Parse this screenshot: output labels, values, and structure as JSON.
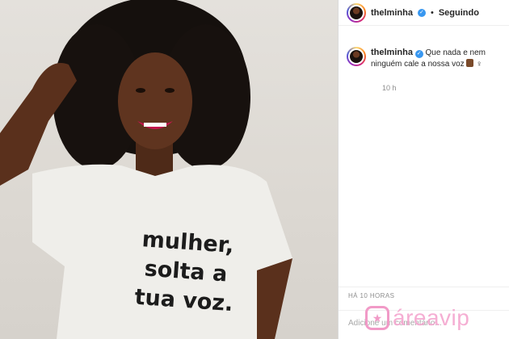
{
  "post": {
    "username": "thelminha",
    "follow_status": "Seguindo",
    "caption_text": "Que nada e nem ninguém cale a nossa voz",
    "caption_time": "10 h",
    "posted_ago": "HÁ 10 HORAS",
    "add_comment_placeholder": "Adicione um comentário..."
  },
  "photo": {
    "shirt_text_line1": "mulher,",
    "shirt_text_line2": "solta a",
    "shirt_text_line3": "tua voz."
  },
  "watermark": {
    "text": "áreavip"
  },
  "colors": {
    "verified": "#3897f0",
    "watermark": "#f4a6cf"
  }
}
